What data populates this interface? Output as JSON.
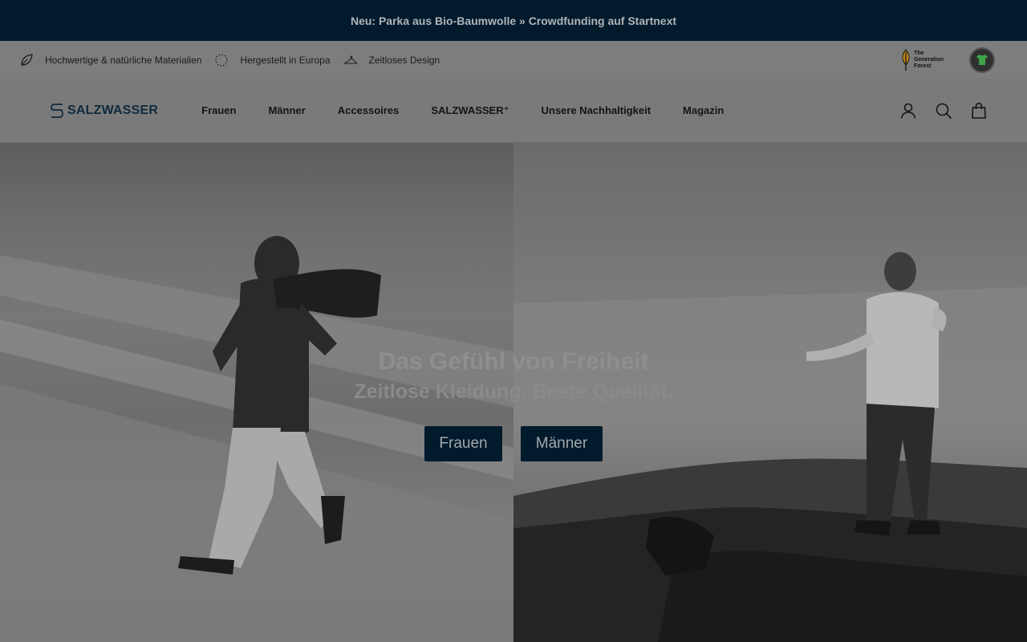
{
  "announcement": {
    "text": "Neu: Parka aus Bio-Baumwolle » Crowdfunding auf Startnext"
  },
  "usp": {
    "items": [
      {
        "label": "Hochwertige & natürliche Materialien",
        "icon": "leaf-icon"
      },
      {
        "label": "Hergestellt in Europa",
        "icon": "eu-stars-icon"
      },
      {
        "label": "Zeitloses Design",
        "icon": "hanger-icon"
      }
    ],
    "badges": {
      "generation_forest_line1": "The",
      "generation_forest_line2": "Generation",
      "generation_forest_line3": "Forest"
    }
  },
  "header": {
    "logo_text": "SALZWASSER",
    "menu": [
      {
        "label": "Frauen"
      },
      {
        "label": "Männer"
      },
      {
        "label": "Accessoires"
      },
      {
        "label": "SALZWASSER⁺"
      },
      {
        "label": "Unsere Nachhaltigkeit"
      },
      {
        "label": "Magazin"
      }
    ]
  },
  "hero": {
    "title": "Das Gefühl von Freiheit",
    "subtitle": "Zeitlose Kleidung. Beste Qualität.",
    "buttons": [
      {
        "label": "Frauen"
      },
      {
        "label": "Männer"
      }
    ]
  },
  "colors": {
    "announcement_bg": "#011a2c",
    "button_bg": "#011a2c",
    "brand_text": "#102a3c"
  }
}
